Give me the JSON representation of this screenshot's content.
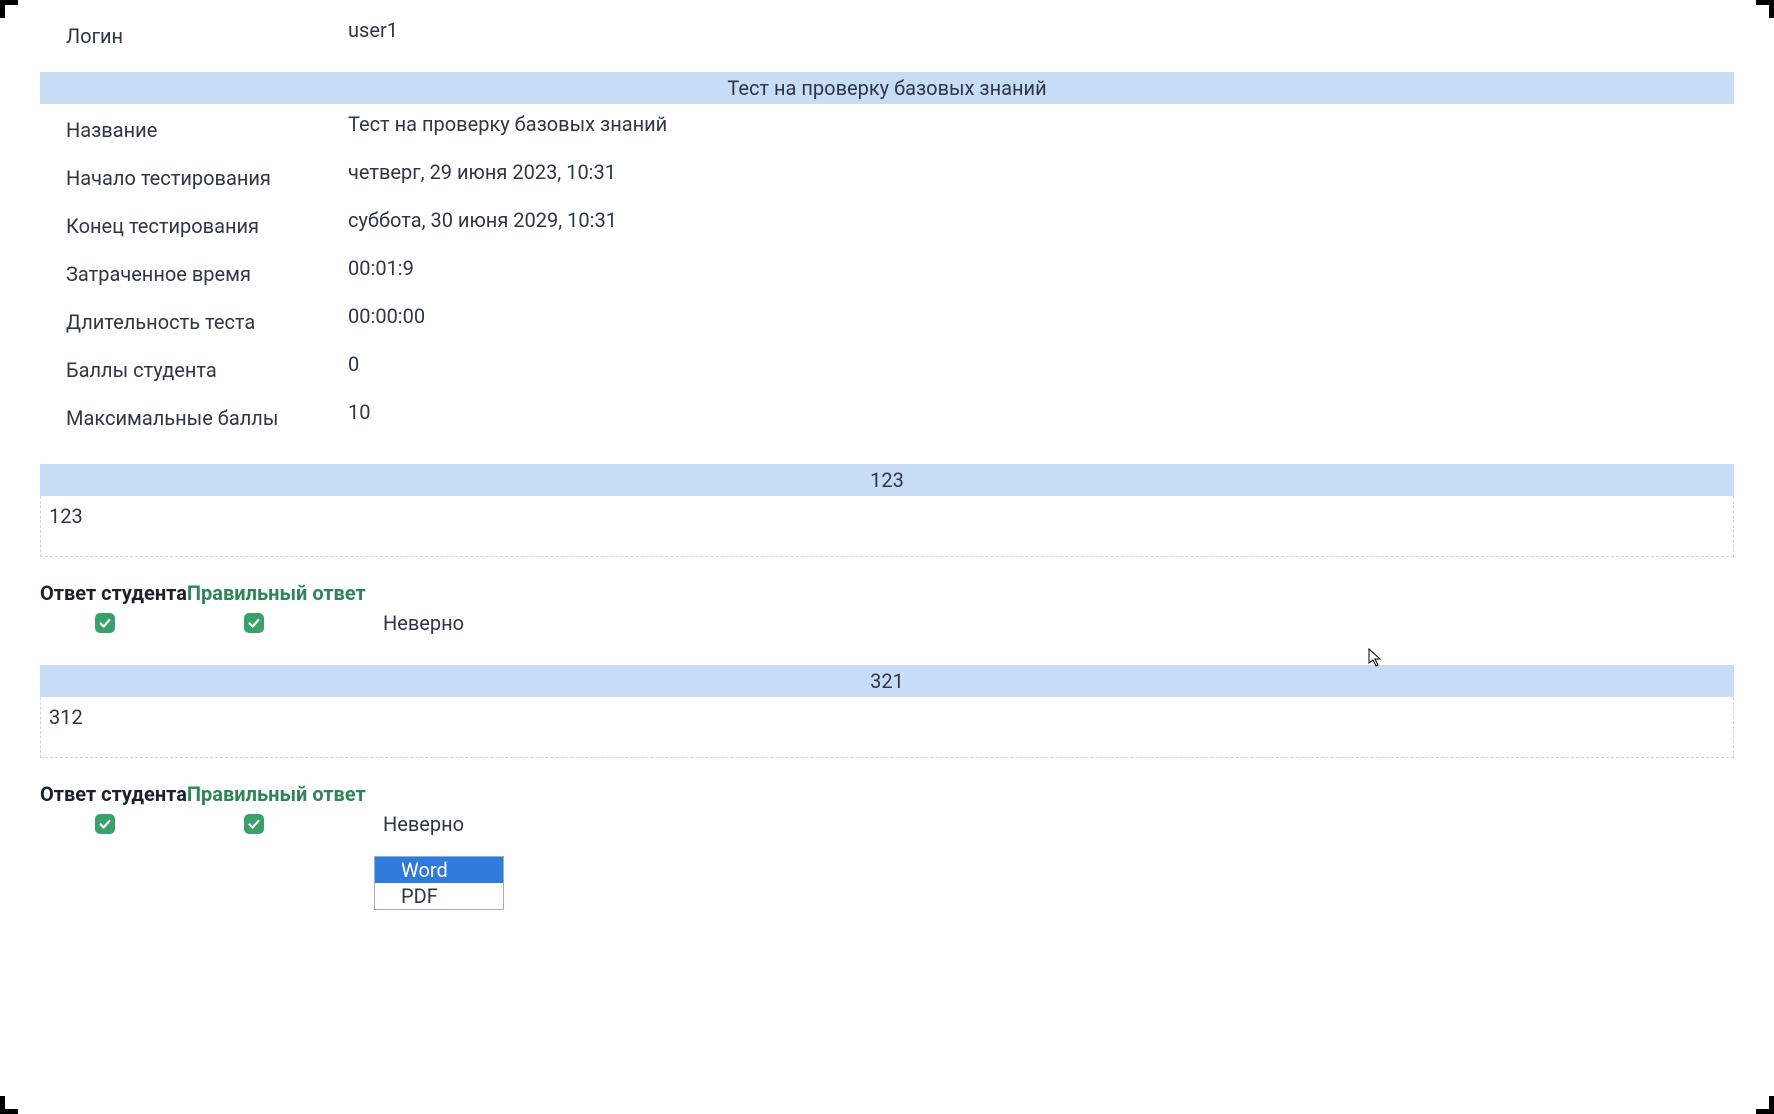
{
  "login": {
    "label": "Логин",
    "value": "user1"
  },
  "test": {
    "header": "Тест на проверку базовых знаний",
    "rows": [
      {
        "label": "Название",
        "value": "Тест на проверку базовых знаний"
      },
      {
        "label": "Начало тестирования",
        "value": "четверг, 29 июня 2023, 10:31"
      },
      {
        "label": "Конец тестирования",
        "value": "суббота, 30 июня 2029, 10:31"
      },
      {
        "label": "Затраченное время",
        "value": "00:01:9"
      },
      {
        "label": "Длительность теста",
        "value": "00:00:00"
      },
      {
        "label": "Баллы студента",
        "value": "0"
      },
      {
        "label": "Максимальные баллы",
        "value": "10"
      }
    ]
  },
  "answers": {
    "student_header": "Ответ студента",
    "correct_header": "Правильный ответ"
  },
  "questions": [
    {
      "title": "123",
      "body": "123",
      "student_checked": true,
      "correct_checked": true,
      "answer_text": "Неверно"
    },
    {
      "title": "321",
      "body": "312",
      "student_checked": true,
      "correct_checked": true,
      "answer_text": "Неверно"
    }
  ],
  "export_dropdown": {
    "options": [
      "Word",
      "PDF"
    ],
    "selected_index": 0
  }
}
